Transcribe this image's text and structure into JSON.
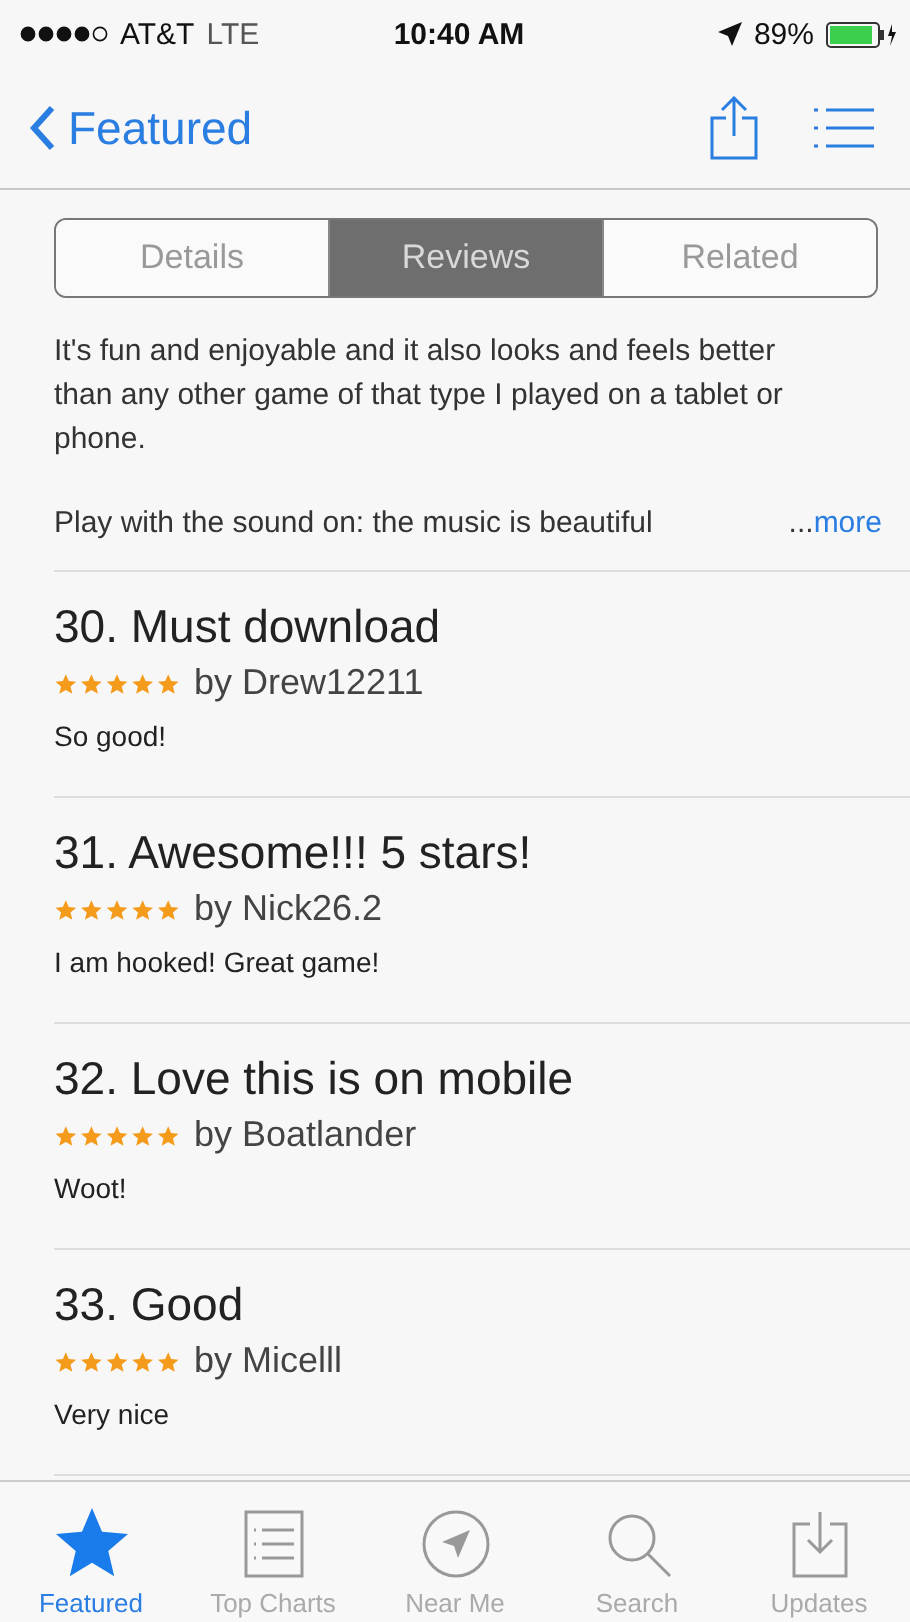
{
  "status_bar": {
    "carrier": "AT&T",
    "network": "LTE",
    "time": "10:40 AM",
    "battery": "89%"
  },
  "nav": {
    "back": "Featured"
  },
  "segments": [
    {
      "label": "Details",
      "selected": false
    },
    {
      "label": "Reviews",
      "selected": true
    },
    {
      "label": "Related",
      "selected": false
    }
  ],
  "intro": {
    "paragraph": "It's fun and enjoyable and it also looks and feels better than any other game of that type I played on a tablet or phone.",
    "last_line": "Play with the sound on: the music is beautiful",
    "ellipsis": "...",
    "more": "more"
  },
  "reviews": [
    {
      "title": "30. Must download",
      "stars": 5,
      "author": "by Drew12211",
      "body": "So good!"
    },
    {
      "title": "31. Awesome!!! 5 stars!",
      "stars": 5,
      "author": "by Nick26.2",
      "body": "I am hooked! Great game!"
    },
    {
      "title": "32. Love this is on mobile",
      "stars": 5,
      "author": "by Boatlander",
      "body": "Woot!"
    },
    {
      "title": "33. Good",
      "stars": 5,
      "author": "by Micelll",
      "body": "Very nice"
    }
  ],
  "tab_bar": [
    {
      "kind": "featured",
      "label": "Featured",
      "selected": true
    },
    {
      "kind": "charts",
      "label": "Top Charts",
      "selected": false
    },
    {
      "kind": "near",
      "label": "Near Me",
      "selected": false
    },
    {
      "kind": "search",
      "label": "Search",
      "selected": false
    },
    {
      "kind": "updates",
      "label": "Updates",
      "selected": false
    }
  ]
}
